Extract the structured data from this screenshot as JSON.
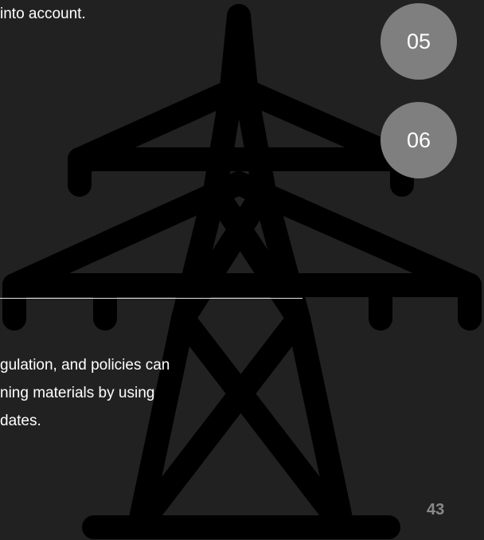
{
  "text": {
    "line_1": "into account.",
    "line_2": "gulation, and policies can",
    "line_3": "ning materials by using",
    "line_4": "dates."
  },
  "badges": [
    {
      "label": "05"
    },
    {
      "label": "06"
    }
  ],
  "page_number": "43",
  "colors": {
    "background": "#212121",
    "pylon": "#000000",
    "badge": "#7f7f7f",
    "text": "#ffffff",
    "page_number": "#8a8a8a",
    "divider": "#e6e6e6"
  },
  "icons": {
    "background_illustration": "power-pylon-icon"
  }
}
